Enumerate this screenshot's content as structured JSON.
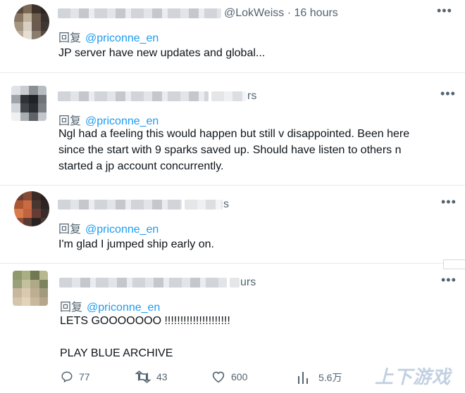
{
  "tweets": [
    {
      "handle_meta": "@LokWeiss · 16 hours",
      "reply_prefix": "回复",
      "reply_handle": "@priconne_en",
      "text": "JP server have new updates and global...",
      "avatar_colors": [
        "#5a4a3a",
        "#7d6a55",
        "#3e3228",
        "#2b2521",
        "#8a7560",
        "#c2b29a",
        "#6c5c4a",
        "#3a312b",
        "#a6967e",
        "#d8cfbf",
        "#6a5b4d",
        "#403731",
        "#b9ab96",
        "#e6dfd2",
        "#8b7d6c",
        "#57493d"
      ]
    },
    {
      "handle_meta": "rs",
      "reply_prefix": "回复",
      "reply_handle": "@priconne_en",
      "text": "Ngl had a feeling this would happen but still v disappointed. Been here\nsince the start with 9 sparks saved up. Should have listen to others n\nstarted a jp account concurrently.",
      "avatar_colors": [
        "#dfe2e6",
        "#c8ccd1",
        "#8a8f95",
        "#b7bcc2",
        "#9fa4aa",
        "#2f3338",
        "#1f2227",
        "#6f747a",
        "#d2d6da",
        "#41464c",
        "#2a2d31",
        "#7b8086",
        "#eef0f2",
        "#a9aeb3",
        "#5f646a",
        "#c3c7cc"
      ]
    },
    {
      "handle_meta": "s",
      "reply_prefix": "回复",
      "reply_handle": "@priconne_en",
      "text": "I'm glad I jumped ship early on.",
      "avatar_colors": [
        "#6b3d2c",
        "#8c4a30",
        "#3b2a25",
        "#2a201e",
        "#b5542e",
        "#d2693c",
        "#4a3630",
        "#2c2422",
        "#e07a45",
        "#c9613a",
        "#6a3c32",
        "#3a2c2a",
        "#9a4a33",
        "#5a3a30",
        "#2b2220",
        "#4a3a36"
      ]
    },
    {
      "handle_meta": "urs",
      "reply_prefix": "回复",
      "reply_handle": "@priconne_en",
      "text": "LETS GOOOOOOO !!!!!!!!!!!!!!!!!!!!!\n\nPLAY BLUE ARCHIVE",
      "avatar_colors": [
        "#8f9a6a",
        "#a9b07d",
        "#6f7a50",
        "#b7b88a",
        "#9aa075",
        "#c4c19a",
        "#b0a984",
        "#7b845a",
        "#c9b89a",
        "#dcc9ac",
        "#bfae90",
        "#a39a7c",
        "#d7c6a8",
        "#e3d4b8",
        "#cbb999",
        "#b6a688"
      ],
      "actions": {
        "replies": "77",
        "retweets": "43",
        "likes": "600",
        "views": "5.6万"
      }
    }
  ],
  "watermark": "上下游戏"
}
